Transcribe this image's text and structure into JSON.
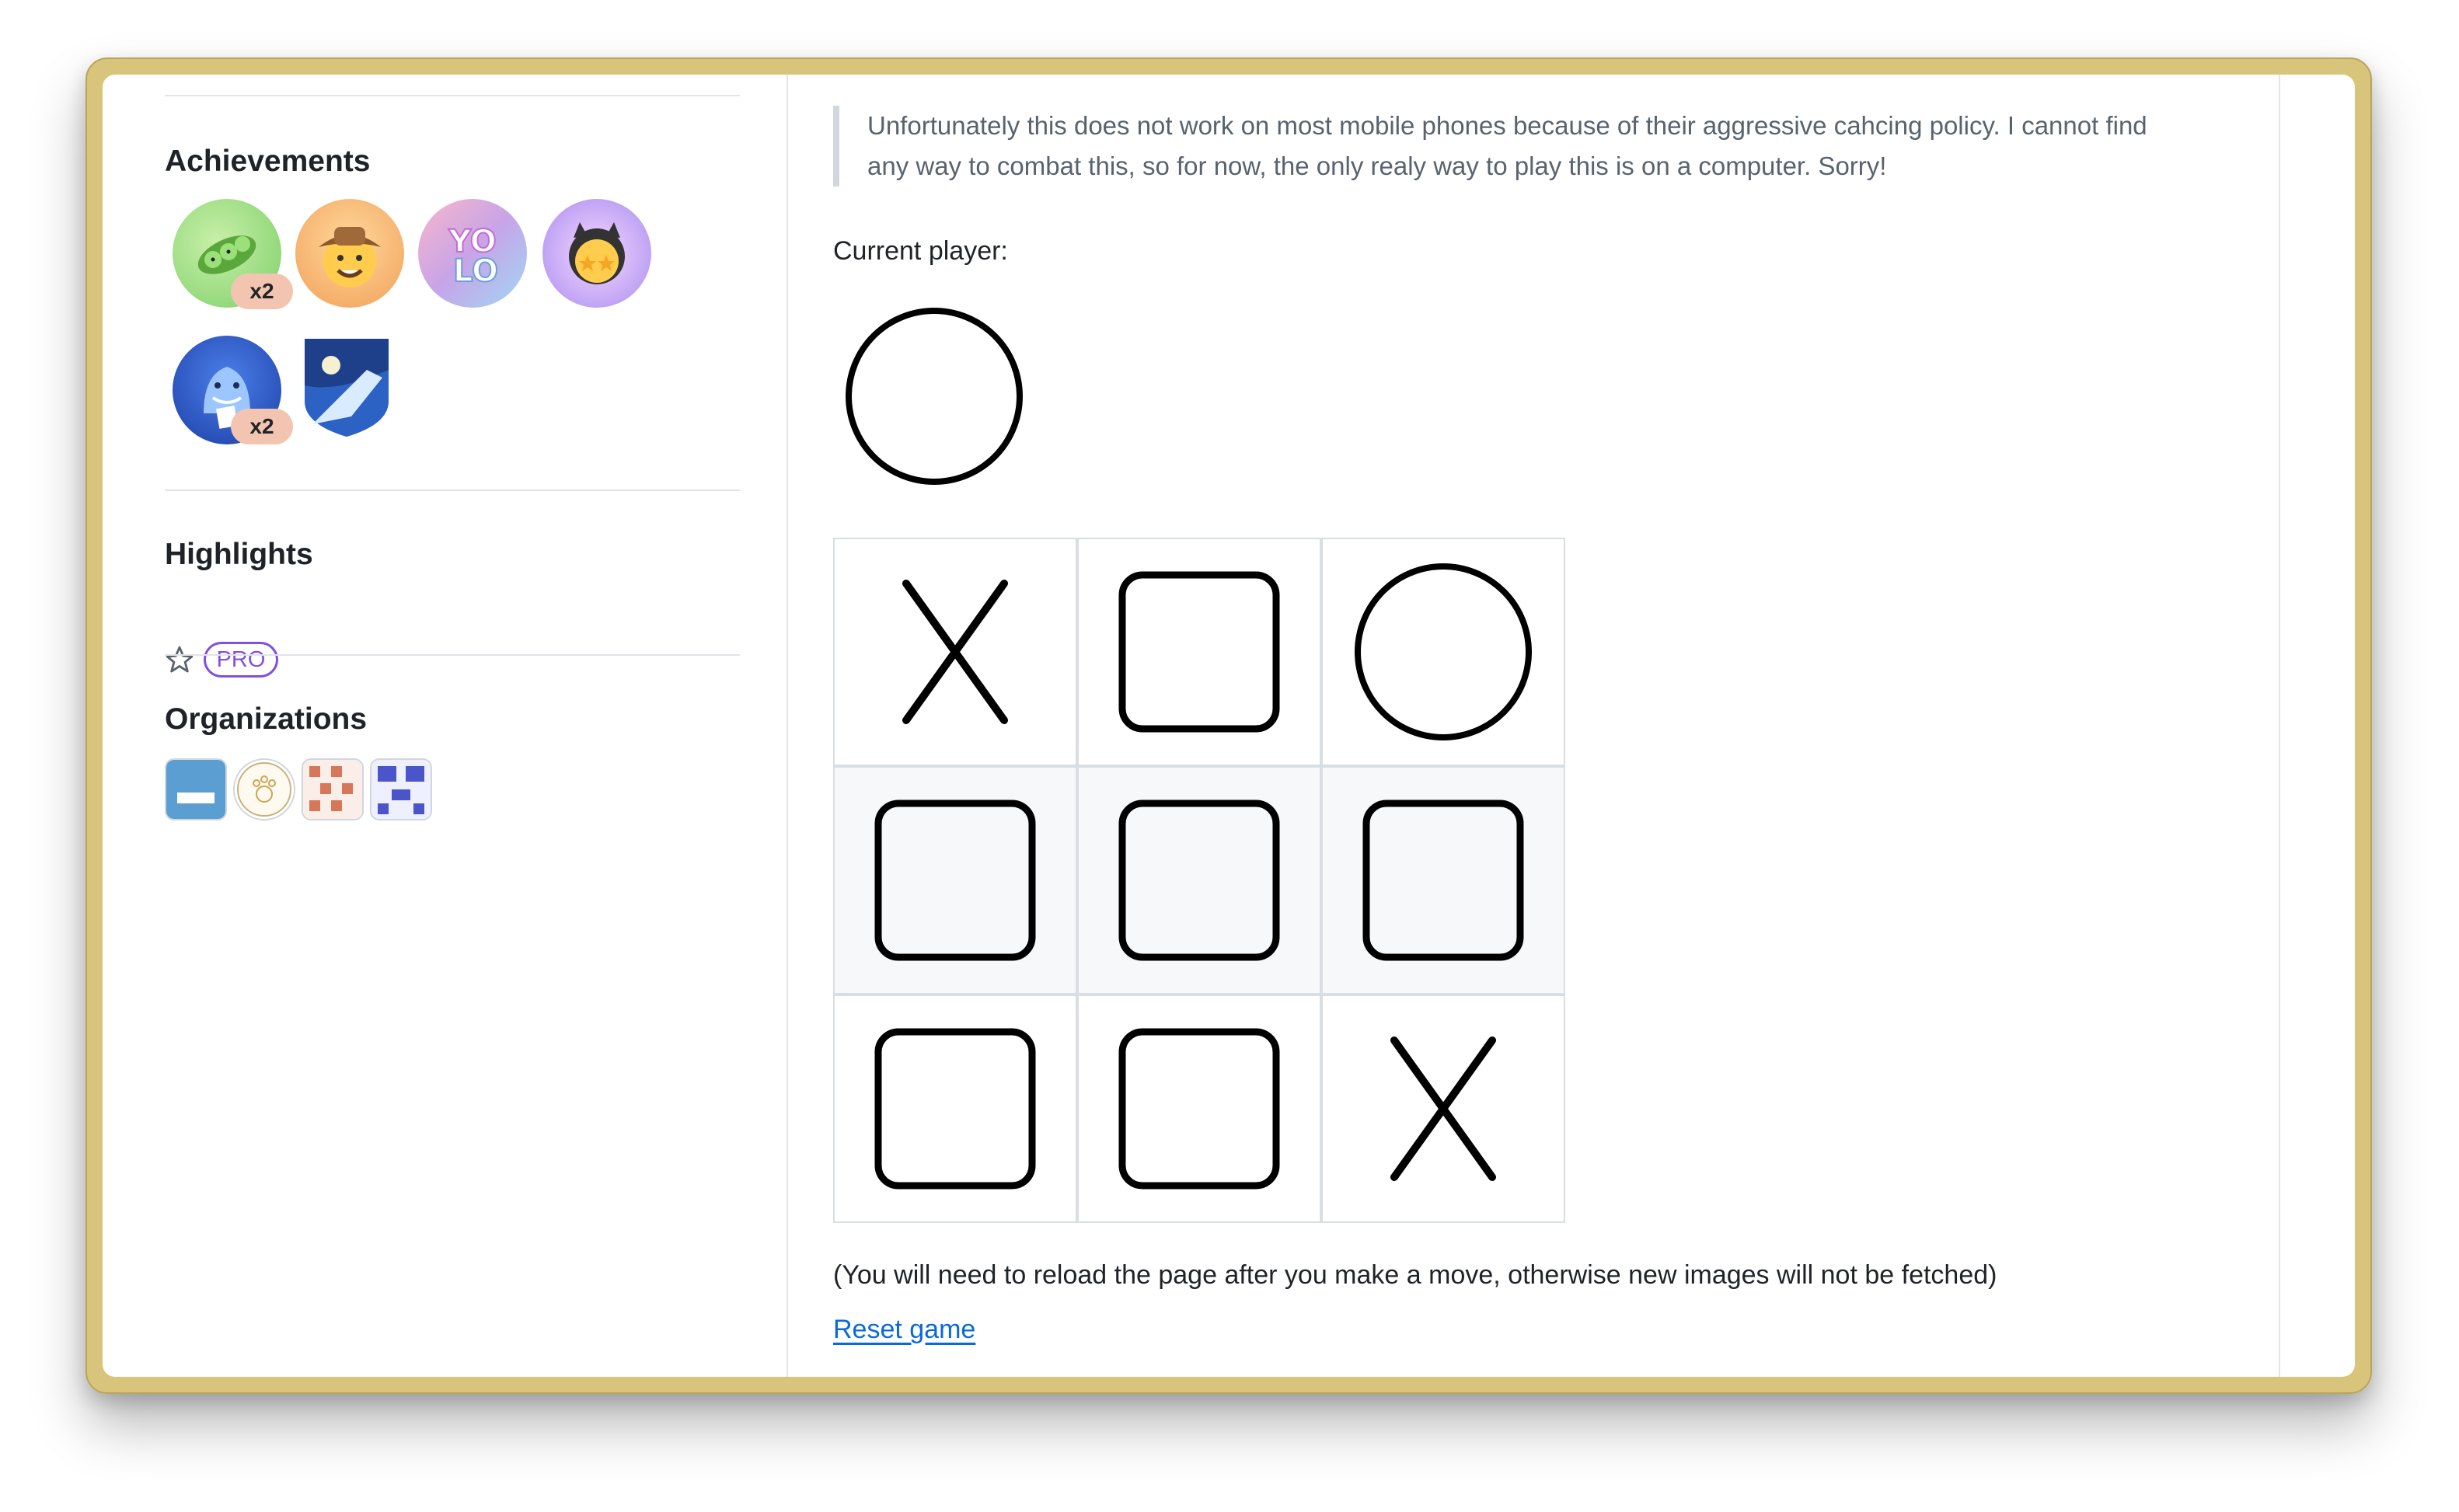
{
  "sidebar": {
    "achievements_title": "Achievements",
    "achievements": [
      {
        "name": "pair-extraordinaire",
        "count": "x2",
        "color": "#7fcf6a"
      },
      {
        "name": "pull-shark-cowboy",
        "count": "",
        "color": "#f2a05a"
      },
      {
        "name": "yolo",
        "count": "",
        "color": "#c7a4e8"
      },
      {
        "name": "starstruck",
        "count": "",
        "color": "#a98ef0"
      },
      {
        "name": "pull-shark",
        "count": "x2",
        "color": "#2f5fd0"
      },
      {
        "name": "arctic-code-vault",
        "count": "",
        "color": "#2c62c4"
      }
    ],
    "highlights_title": "Highlights",
    "highlights_badge": "PRO",
    "organizations_title": "Organizations"
  },
  "main": {
    "notice": "Unfortunately this does not work on most mobile phones because of their aggressive cahcing policy. I cannot find any way to combat this, so for now, the only realy way to play this is on a computer. Sorry!",
    "current_player_label": "Current player:",
    "current_player": "O",
    "board": [
      "X",
      "",
      "O",
      "",
      "",
      "",
      "",
      "",
      "X"
    ],
    "reload_note": "(You will need to reload the page after you make a move, otherwise new images will not be fetched)",
    "reset_label": "Reset game"
  },
  "colors": {
    "frame": "#d8c47a",
    "link": "#0969da",
    "pro": "#8250df"
  }
}
